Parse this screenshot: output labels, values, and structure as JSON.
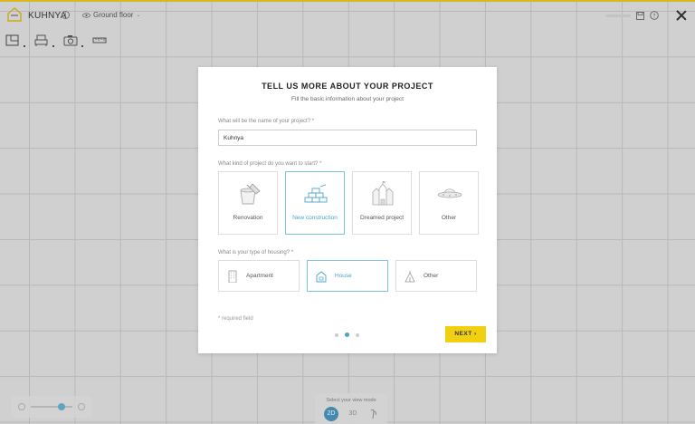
{
  "app": {
    "title": "KUHNYA",
    "info_icon": "info-icon",
    "floor": "Ground floor"
  },
  "colors": {
    "accent": "#e8c421",
    "selection": "#4aa3c9",
    "next_button": "#f0d010"
  },
  "toolbar": {
    "icons": [
      "floorplan-icon",
      "furniture-icon",
      "camera-icon",
      "ruler-icon"
    ]
  },
  "modal": {
    "title": "TELL US MORE ABOUT YOUR PROJECT",
    "subtitle": "Fill the basic information about your project",
    "name_question": "What will be the name of your project? *",
    "name_value": "Kuhnya",
    "kind_question": "What kind of project do you want to start? *",
    "kinds": [
      {
        "label": "Renovation",
        "icon": "paint-bucket-icon",
        "selected": false
      },
      {
        "label": "New construction",
        "icon": "bricks-icon",
        "selected": true
      },
      {
        "label": "Dreamed project",
        "icon": "castle-icon",
        "selected": false
      },
      {
        "label": "Other",
        "icon": "ufo-icon",
        "selected": false
      }
    ],
    "housing_question": "What is your type of housing? *",
    "housing": [
      {
        "label": "Apartment",
        "icon": "building-icon",
        "selected": false
      },
      {
        "label": "House",
        "icon": "house-icon",
        "selected": true
      },
      {
        "label": "Other",
        "icon": "tent-icon",
        "selected": false
      }
    ],
    "required_note": "* required field",
    "steps": 3,
    "current_step": 2,
    "next_label": "NEXT"
  },
  "view_mode": {
    "label": "Select your view mode",
    "options": [
      "2D",
      "3D",
      "walk-icon"
    ],
    "active": "2D"
  },
  "zoom": {
    "level": 0.65
  }
}
